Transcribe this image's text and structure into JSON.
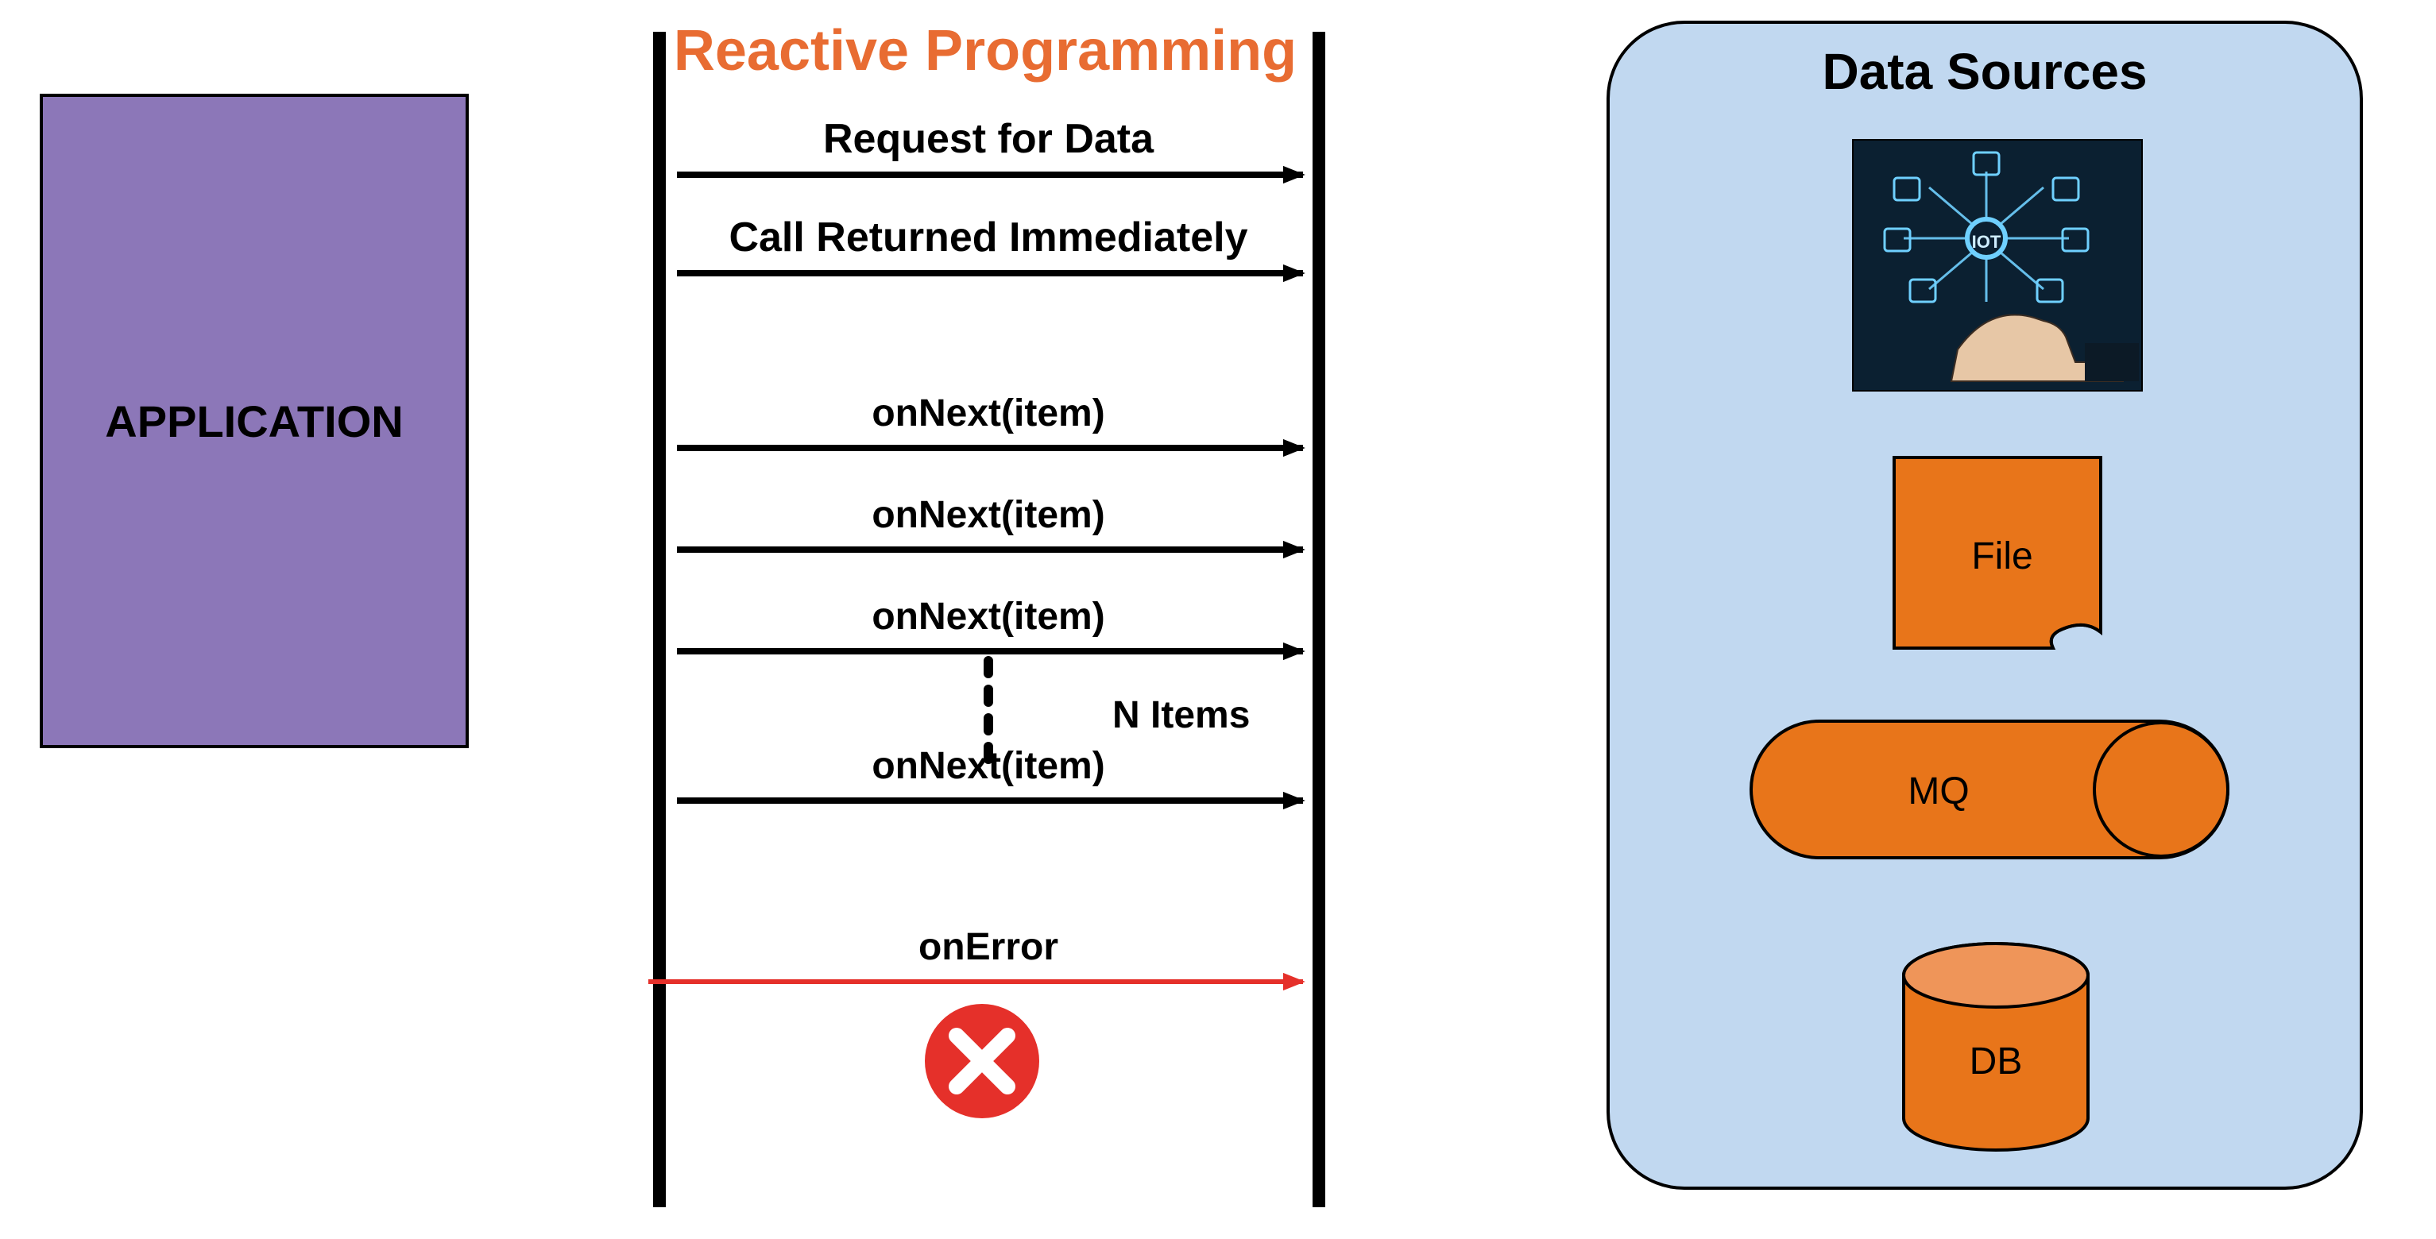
{
  "title": "Reactive Programming",
  "application_label": "APPLICATION",
  "data_sources": {
    "title": "Data Sources",
    "file_label": "File",
    "mq_label": "MQ",
    "db_label": "DB"
  },
  "arrows": {
    "request": "Request for Data",
    "call_returned": "Call Returned Immediately",
    "onnext1": "onNext(item)",
    "onnext2": "onNext(item)",
    "onnext3": "onNext(item)",
    "nitems": "N Items",
    "onnext4": "onNext(item)",
    "onerror": "onError"
  },
  "colors": {
    "purple": "#8c77b8",
    "orange_title": "#e86c32",
    "orange_fill": "#e8751a",
    "blue_panel": "#c1d8f0",
    "red": "#e5302a",
    "black": "#000000",
    "iot_bg": "#0b2031",
    "iot_glow": "#6fd0ff"
  }
}
